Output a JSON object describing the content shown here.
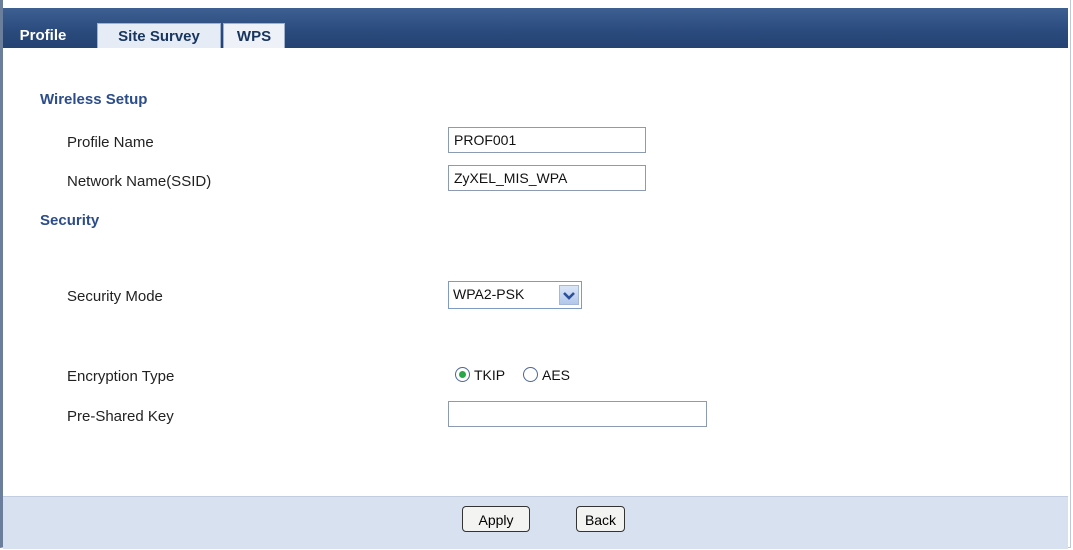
{
  "tabs": [
    {
      "label": "Profile"
    },
    {
      "label": "Site Survey"
    },
    {
      "label": "WPS"
    }
  ],
  "wireless_setup": {
    "heading": "Wireless Setup",
    "profile_name_label": "Profile Name",
    "profile_name_value": "PROF001",
    "ssid_label": "Network Name(SSID)",
    "ssid_value": "ZyXEL_MIS_WPA"
  },
  "security": {
    "heading": "Security",
    "mode_label": "Security Mode",
    "mode_value": "WPA2-PSK",
    "encryption_label": "Encryption Type",
    "encryption_options": [
      "TKIP",
      "AES"
    ],
    "encryption_selected": "TKIP",
    "psk_label": "Pre-Shared Key",
    "psk_value": ""
  },
  "buttons": {
    "apply": "Apply",
    "back": "Back"
  },
  "icons": {
    "dropdown": "chevron-down-icon"
  }
}
